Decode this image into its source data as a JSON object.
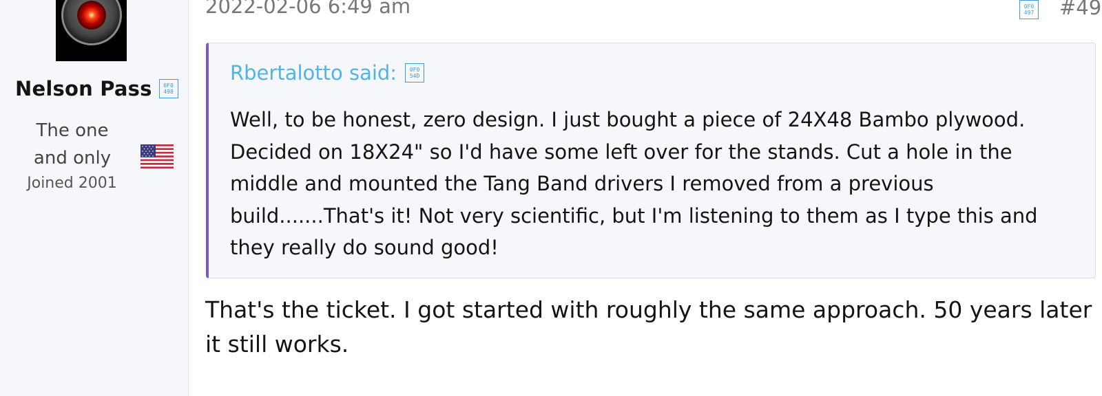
{
  "author": {
    "name": "Nelson Pass",
    "badge_glyph_top": "0F0",
    "badge_glyph_bottom": "498",
    "title": "The one and only",
    "joined": "Joined 2001",
    "avatar_icon": "hal-9000-eye-icon",
    "flag_icon": "us-flag-icon"
  },
  "post": {
    "date": "2022-02-06 6:49 am",
    "share_glyph_top": "0F0",
    "share_glyph_bottom": "497",
    "number": "#49"
  },
  "quote": {
    "author": "Rbertalotto said:",
    "jump_glyph_top": "0F0",
    "jump_glyph_bottom": "54D",
    "text": "Well, to be honest, zero design. I just bought a piece of 24X48 Bambo plywood. Decided on 18X24\" so I'd have some left over for the stands. Cut a hole in the middle and mounted the Tang Band drivers I removed from a previous build.......That's it! Not very scientific, but I'm listening to them as I type this and they really do sound good!"
  },
  "reply": {
    "text": "That's the ticket. I got started with roughly the same approach. 50 years later it still works."
  },
  "colors": {
    "sidebar_bg": "#f5f7fb",
    "quote_accent": "#7e57c2",
    "quote_author": "#4fb4e8",
    "glyph_box": "#3b9ae0"
  }
}
